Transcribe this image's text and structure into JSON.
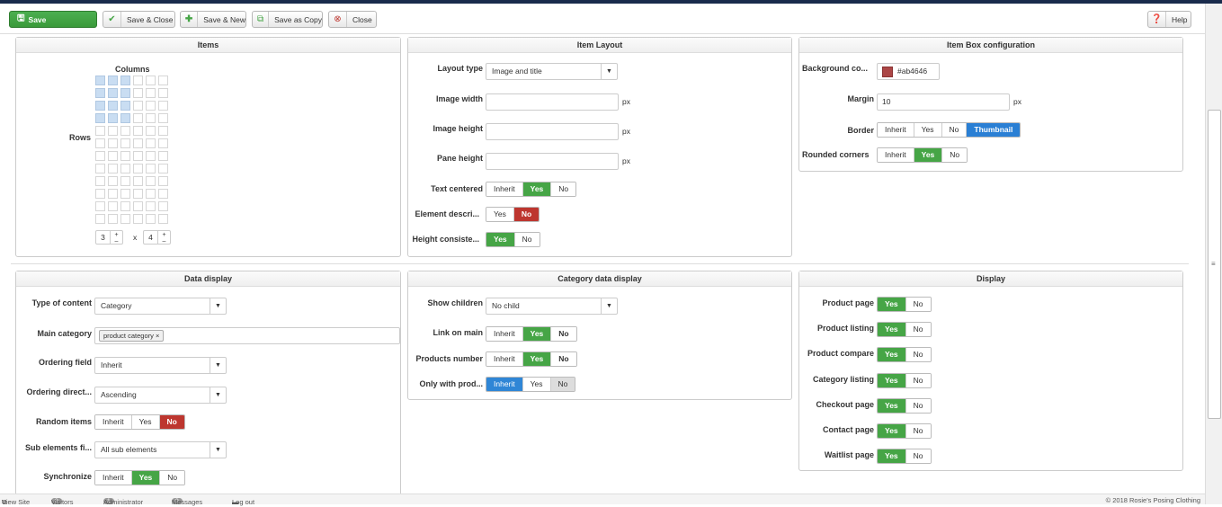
{
  "toolbar": {
    "save": "Save",
    "save_close": "Save & Close",
    "save_new": "Save & New",
    "save_copy": "Save as Copy",
    "close": "Close",
    "help": "Help"
  },
  "items_panel": {
    "title": "Items",
    "columns_label": "Columns",
    "rows_label": "Rows",
    "rows_value": "3",
    "x": "x",
    "cols_value": "4",
    "plus": "+",
    "minus": "–"
  },
  "item_layout": {
    "title": "Item Layout",
    "layout_type_label": "Layout type",
    "layout_type_value": "Image and title",
    "image_width_label": "Image width",
    "image_height_label": "Image height",
    "pane_height_label": "Pane height",
    "px": "px",
    "text_centered_label": "Text centered",
    "element_desc_label": "Element descri...",
    "height_consistent_label": "Height consiste...",
    "inherit": "Inherit",
    "yes": "Yes",
    "no": "No"
  },
  "item_box": {
    "title": "Item Box configuration",
    "bg_color_label": "Background co...",
    "bg_color_value": "#ab4646",
    "margin_label": "Margin",
    "margin_value": "10",
    "px": "px",
    "border_label": "Border",
    "thumbnail": "Thumbnail",
    "rounded_label": "Rounded corners"
  },
  "data_display": {
    "title": "Data display",
    "type_label": "Type of content",
    "type_value": "Category",
    "main_cat_label": "Main category",
    "main_cat_tag": "product category",
    "tag_remove": "×",
    "ordering_field_label": "Ordering field",
    "ordering_field_value": "Inherit",
    "ordering_dir_label": "Ordering direct...",
    "ordering_dir_value": "Ascending",
    "random_label": "Random items",
    "sub_elements_label": "Sub elements fi...",
    "sub_elements_value": "All sub elements",
    "sync_label": "Synchronize"
  },
  "category_display": {
    "title": "Category data display",
    "show_children_label": "Show children",
    "show_children_value": "No child",
    "link_main_label": "Link on main",
    "products_number_label": "Products number",
    "only_with_label": "Only with prod..."
  },
  "display": {
    "title": "Display",
    "product_page": "Product page",
    "product_listing": "Product listing",
    "product_compare": "Product compare",
    "category_listing": "Category listing",
    "checkout_page": "Checkout page",
    "contact_page": "Contact page",
    "waitlist_page": "Waitlist page"
  },
  "status": {
    "view_site": "View Site",
    "visitors_count": "0",
    "visitors": "Visitors",
    "admin_count": "1",
    "administrator": "Administrator",
    "messages_count": "0",
    "messages": "Messages",
    "logout": "Log out",
    "copyright": "© 2018 Rosie's Posing Clothing"
  },
  "colors": {
    "green": "#46a546",
    "red": "#bd362f",
    "blue": "#2a7fd4",
    "swatch": "#ab4646"
  }
}
